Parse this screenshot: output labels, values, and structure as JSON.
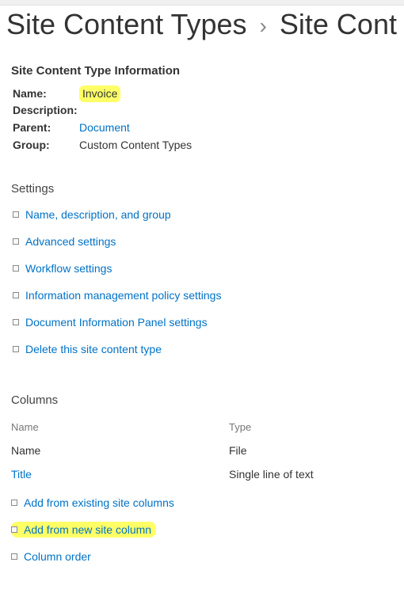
{
  "breadcrumb": {
    "root": "Site Content Types",
    "current": "Site Cont"
  },
  "info": {
    "heading": "Site Content Type Information",
    "name_label": "Name:",
    "name_value": "Invoice",
    "description_label": "Description:",
    "description_value": "",
    "parent_label": "Parent:",
    "parent_value": "Document",
    "group_label": "Group:",
    "group_value": "Custom Content Types"
  },
  "settings": {
    "heading": "Settings",
    "links": [
      "Name, description, and group",
      "Advanced settings",
      "Workflow settings",
      "Information management policy settings",
      "Document Information Panel settings",
      "Delete this site content type"
    ]
  },
  "columns": {
    "heading": "Columns",
    "header_name": "Name",
    "header_type": "Type",
    "rows": [
      {
        "name": "Name",
        "type": "File",
        "is_link": false
      },
      {
        "name": "Title",
        "type": "Single line of text",
        "is_link": true
      }
    ],
    "actions": [
      "Add from existing site columns",
      "Add from new site column",
      "Column order"
    ]
  }
}
